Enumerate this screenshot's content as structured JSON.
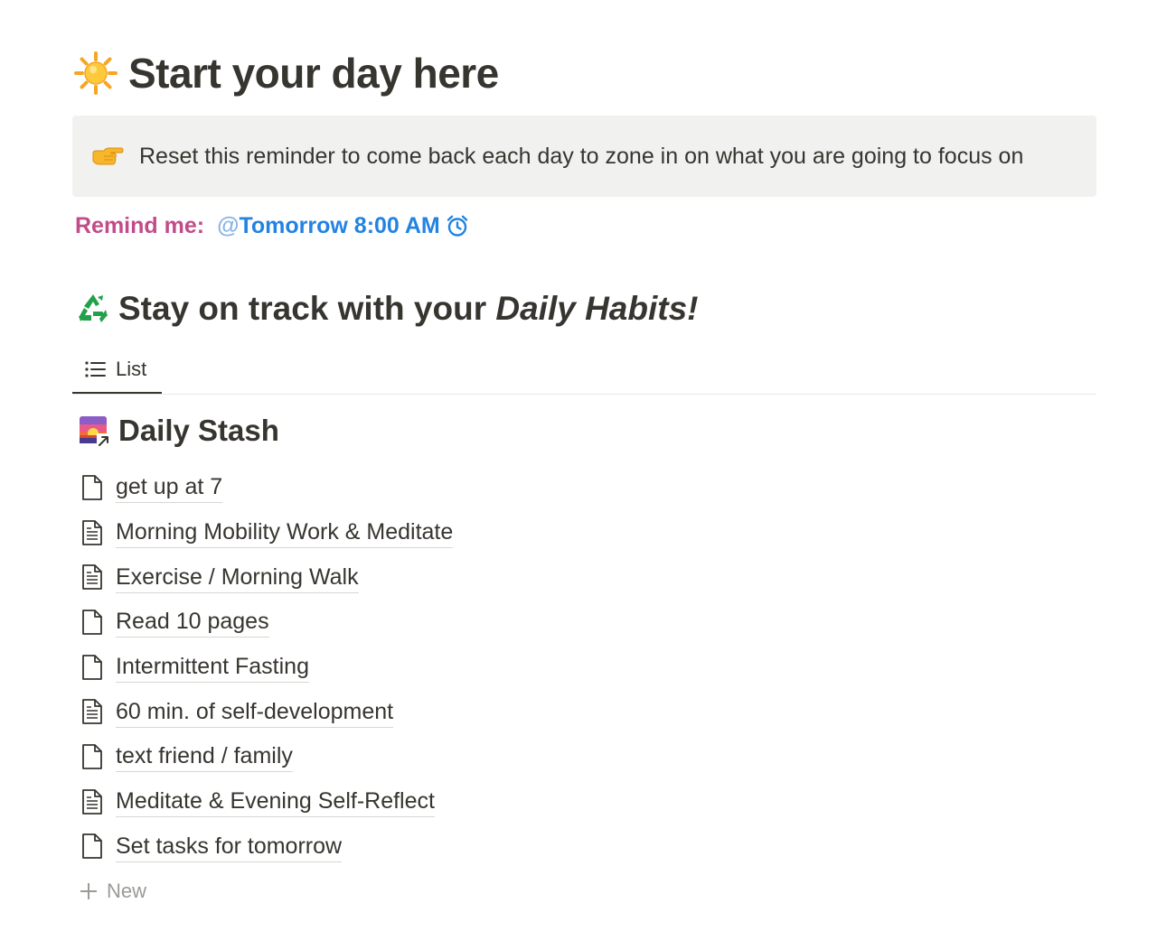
{
  "page": {
    "title": "Start your day here",
    "title_icon": "sun-icon"
  },
  "callout": {
    "icon": "pointing-hand-icon",
    "text": "Reset this reminder to come back each day to zone in on what you are going to focus on"
  },
  "reminder": {
    "label": "Remind me:",
    "at_symbol": "@",
    "date": "Tomorrow 8:00 AM",
    "icon": "alarm-clock-icon",
    "label_color": "#c14c8a",
    "date_color": "#2383e2"
  },
  "habits_heading": {
    "icon": "recycle-icon",
    "text_plain": "Stay on track with your ",
    "text_italic": "Daily Habits!"
  },
  "view_tabs": [
    {
      "label": "List",
      "icon": "list-icon",
      "active": true
    }
  ],
  "database": {
    "title": "Daily Stash",
    "icon": "sunrise-linked-icon",
    "items": [
      {
        "label": "get up at 7",
        "icon": "page-icon"
      },
      {
        "label": "Morning Mobility Work & Meditate",
        "icon": "page-text-icon"
      },
      {
        "label": "Exercise / Morning Walk",
        "icon": "page-text-icon"
      },
      {
        "label": "Read 10 pages",
        "icon": "page-icon"
      },
      {
        "label": "Intermittent Fasting",
        "icon": "page-icon"
      },
      {
        "label": "60 min. of self-development",
        "icon": "page-text-icon"
      },
      {
        "label": "text friend / family",
        "icon": "page-icon"
      },
      {
        "label": "Meditate & Evening Self-Reflect",
        "icon": "page-text-icon"
      },
      {
        "label": "Set tasks for tomorrow",
        "icon": "page-icon"
      }
    ],
    "new_label": "New"
  }
}
